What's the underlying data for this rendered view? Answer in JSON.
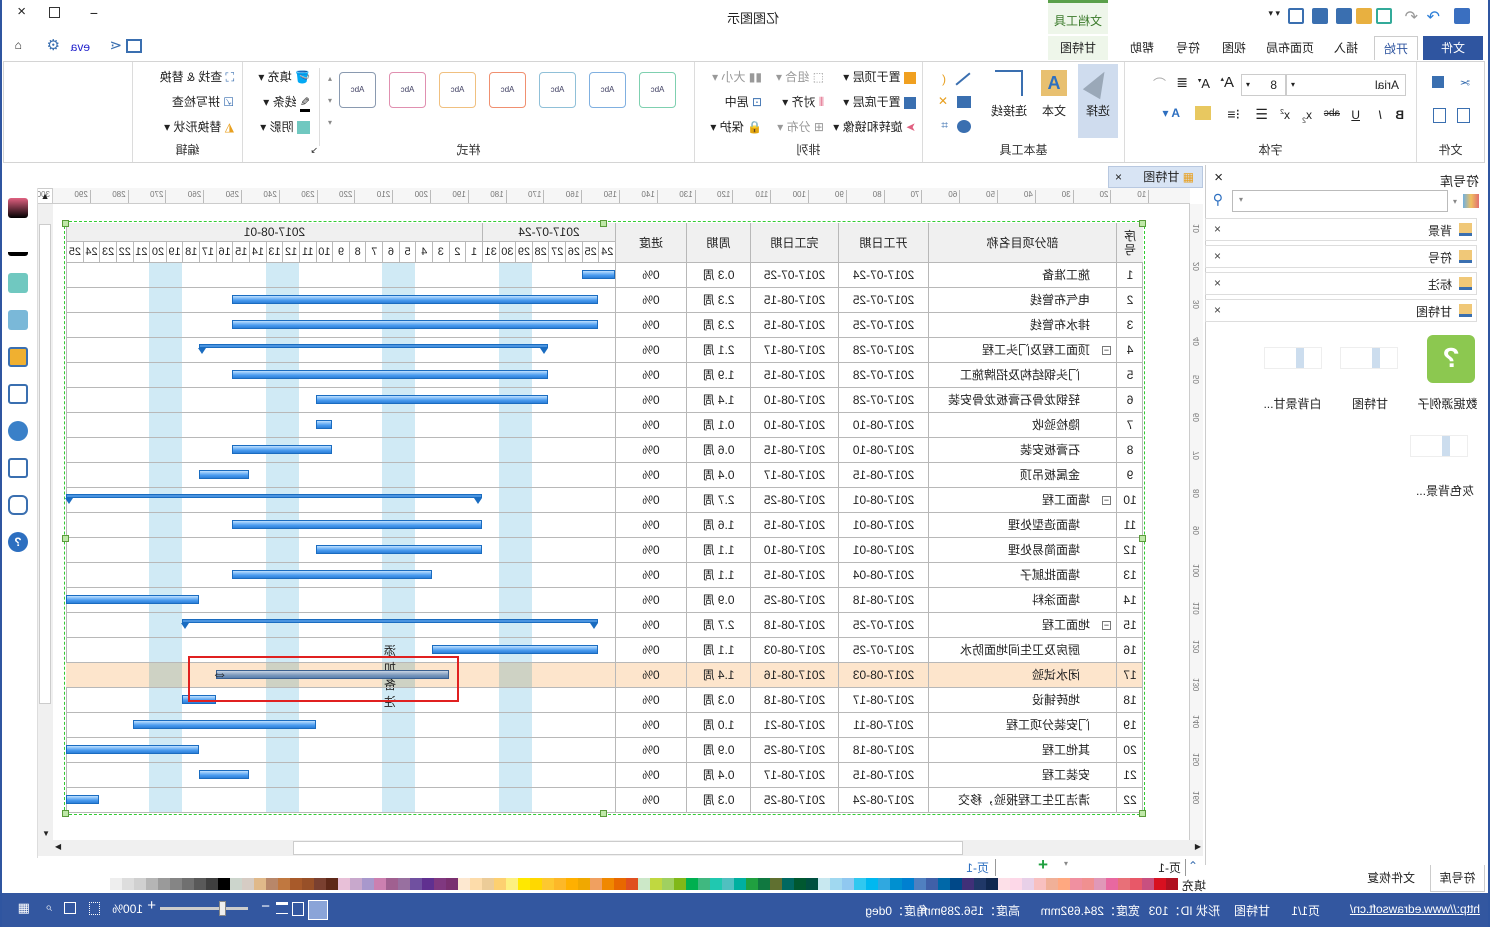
{
  "app": {
    "title": "亿图图示",
    "context_tab": "文档工具"
  },
  "quick_access": {
    "user": "eva"
  },
  "tabs": [
    "文件",
    "开始",
    "插入",
    "页面布局",
    "视图",
    "符号",
    "帮助",
    "甘特图"
  ],
  "active_tab": "开始",
  "ribbon": {
    "file_group": "文件",
    "font_group": {
      "label": "字体",
      "font_name": "Arial",
      "font_size": "8"
    },
    "tools_group": {
      "label": "基本工具",
      "select": "选择",
      "text": "文本",
      "connector": "连接线"
    },
    "arrange_group": {
      "label": "排列",
      "bring_front": "置于顶层",
      "send_back": "置于底层",
      "rotate": "旋转和镜像",
      "align": "对齐",
      "group": "组合",
      "distribute": "分布",
      "size": "大小",
      "center": "居中",
      "protect": "保护"
    },
    "style_group": {
      "label": "样式",
      "sample": "Abc",
      "fill": "填充",
      "line": "线条",
      "shadow": "阴影",
      "swatch_colors": [
        "#7fd0b0",
        "#80b0e0",
        "#90c0d8",
        "#f09070",
        "#f0c080",
        "#e090b0",
        "#8a9ab0"
      ]
    },
    "edit_group": {
      "label": "编辑",
      "find": "查找 & 替换",
      "spell": "拼写检查",
      "replace_shape": "替换形状"
    }
  },
  "library": {
    "title": "符号库",
    "categories": [
      "背景",
      "符号",
      "标注",
      "甘特图"
    ],
    "items": [
      {
        "label": "数据源例子",
        "icon": "help-bubble-icon"
      },
      {
        "label": "甘特图",
        "icon": "gantt-thumbnail"
      },
      {
        "label": "白背景甘...",
        "icon": "gantt-thumbnail"
      },
      {
        "label": "灰色背景...",
        "icon": "gantt-thumbnail"
      }
    ],
    "bottom_tabs": [
      "符号库",
      "文件恢复"
    ]
  },
  "document_tab": "甘特图",
  "ruler": {
    "h_labels": [
      10,
      20,
      30,
      40,
      50,
      60,
      70,
      80,
      90,
      100,
      110,
      120,
      130,
      140,
      150,
      160,
      170,
      180,
      190,
      200,
      210,
      220,
      230,
      240,
      250,
      260,
      270,
      280,
      290,
      300
    ],
    "v_labels": [
      10,
      20,
      30,
      40,
      50,
      60,
      70,
      80,
      90,
      100,
      110,
      120,
      130,
      140,
      150,
      160
    ]
  },
  "gantt": {
    "headers": {
      "id": "序号",
      "name": "部分项目名称",
      "start": "开工日期",
      "end": "完工日期",
      "duration": "周期",
      "progress": "进度"
    },
    "timeline_start": "2017-07-24",
    "timeline_end": "2017-08-25",
    "week_labels": [
      "2017-07-24",
      "2017-08-01"
    ],
    "day_labels": [
      "24",
      "25",
      "26",
      "27",
      "28",
      "29",
      "30",
      "31",
      "1",
      "2",
      "3",
      "4",
      "5",
      "6",
      "7",
      "8",
      "9",
      "10",
      "11",
      "12",
      "13",
      "14",
      "15",
      "16",
      "17",
      "18",
      "19",
      "20",
      "21",
      "22",
      "23",
      "24",
      "25"
    ],
    "selected_row": 17,
    "annotation": "添加备注",
    "rows": [
      {
        "id": "1",
        "name": "施工准备",
        "start": "2017-07-24",
        "end": "2017-07-25",
        "duration": "0.3 周",
        "progress": "0%",
        "level": 0
      },
      {
        "id": "2",
        "name": "电气布管线",
        "start": "2017-07-25",
        "end": "2017-08-15",
        "duration": "2.3 周",
        "progress": "0%",
        "level": 0
      },
      {
        "id": "3",
        "name": "排水布管线",
        "start": "2017-07-25",
        "end": "2017-08-15",
        "duration": "2.3 周",
        "progress": "0%",
        "level": 0
      },
      {
        "id": "4",
        "name": "顶面工程及门头工程",
        "start": "2017-07-28",
        "end": "2017-08-17",
        "duration": "2.1 周",
        "progress": "0%",
        "level": 0,
        "summary": true
      },
      {
        "id": "5",
        "name": "门头钢结构及招牌施工",
        "start": "2017-07-28",
        "end": "2017-08-15",
        "duration": "1.9 周",
        "progress": "0%",
        "level": 1
      },
      {
        "id": "6",
        "name": "轻钢龙骨石膏板龙骨安装",
        "start": "2017-07-28",
        "end": "2017-08-10",
        "duration": "1.4 周",
        "progress": "0%",
        "level": 1
      },
      {
        "id": "7",
        "name": "隐检验收",
        "start": "2017-08-10",
        "end": "2017-08-10",
        "duration": "0.1 周",
        "progress": "0%",
        "level": 1
      },
      {
        "id": "8",
        "name": "石膏板安装",
        "start": "2017-08-10",
        "end": "2017-08-15",
        "duration": "0.6 周",
        "progress": "0%",
        "level": 1
      },
      {
        "id": "9",
        "name": "金属板吊顶",
        "start": "2017-08-15",
        "end": "2017-08-17",
        "duration": "0.4 周",
        "progress": "0%",
        "level": 1
      },
      {
        "id": "10",
        "name": "墙面工程",
        "start": "2017-08-01",
        "end": "2017-08-25",
        "duration": "2.7 周",
        "progress": "0%",
        "level": 0,
        "summary": true
      },
      {
        "id": "11",
        "name": "墙面造型处理",
        "start": "2017-08-01",
        "end": "2017-08-15",
        "duration": "1.6 周",
        "progress": "0%",
        "level": 1
      },
      {
        "id": "12",
        "name": "墙面简易处理",
        "start": "2017-08-01",
        "end": "2017-08-10",
        "duration": "1.1 周",
        "progress": "0%",
        "level": 1
      },
      {
        "id": "13",
        "name": "墙面批腻子",
        "start": "2017-08-04",
        "end": "2017-08-15",
        "duration": "1.1 周",
        "progress": "0%",
        "level": 1
      },
      {
        "id": "14",
        "name": "墙面涂料",
        "start": "2017-08-18",
        "end": "2017-08-25",
        "duration": "0.9 周",
        "progress": "0%",
        "level": 1
      },
      {
        "id": "15",
        "name": "地面工程",
        "start": "2017-07-25",
        "end": "2017-08-18",
        "duration": "2.7 周",
        "progress": "0%",
        "level": 0,
        "summary": true
      },
      {
        "id": "16",
        "name": "厨房及卫生间地面防水",
        "start": "2017-07-25",
        "end": "2017-08-03",
        "duration": "1.1 周",
        "progress": "0%",
        "level": 1
      },
      {
        "id": "17",
        "name": "闭水试验",
        "start": "2017-08-03",
        "end": "2017-08-16",
        "duration": "1.4 周",
        "progress": "0%",
        "level": 1
      },
      {
        "id": "18",
        "name": "地砖铺设",
        "start": "2017-08-17",
        "end": "2017-08-18",
        "duration": "0.3 周",
        "progress": "0%",
        "level": 1
      },
      {
        "id": "19",
        "name": "门安装分项工程",
        "start": "2017-08-11",
        "end": "2017-08-21",
        "duration": "1.0 周",
        "progress": "0%",
        "level": 0
      },
      {
        "id": "20",
        "name": "其他工程",
        "start": "2017-08-18",
        "end": "2017-08-25",
        "duration": "0.9 周",
        "progress": "0%",
        "level": 0
      },
      {
        "id": "21",
        "name": "安装工程",
        "start": "2017-08-15",
        "end": "2017-08-17",
        "duration": "0.4 周",
        "progress": "0%",
        "level": 0
      },
      {
        "id": "22",
        "name": "清洁卫生工程报验，移交",
        "start": "2017-08-24",
        "end": "2017-08-25",
        "duration": "0.3 周",
        "progress": "0%",
        "level": 0
      }
    ]
  },
  "pages": {
    "current": "页-1",
    "tab": "页-1"
  },
  "palette": {
    "label": "填充",
    "colors": [
      "#eeeeee",
      "#dddddd",
      "#d0d0d0",
      "#b5b5b5",
      "#9a9a9a",
      "#858585",
      "#707070",
      "#595959",
      "#3f3f3f",
      "#000000",
      "#ccd5cc",
      "#d6ccc4",
      "#e0b98a",
      "#b8876a",
      "#c07840",
      "#a85a2a",
      "#985028",
      "#7a4030",
      "#5e2818",
      "#e8c0d8",
      "#c8a8cc",
      "#a898cc",
      "#cc80b0",
      "#a06090",
      "#9870a0",
      "#7050a0",
      "#603090",
      "#803880",
      "#7a3070",
      "#fde8d0",
      "#fddcaa",
      "#eccc98",
      "#fdd070",
      "#fdf080",
      "#ffe800",
      "#ffd800",
      "#fdc830",
      "#fdb828",
      "#ffb000",
      "#f0a800",
      "#f0a060",
      "#f08800",
      "#e86800",
      "#e05020",
      "#cce8c8",
      "#c0d840",
      "#a0d060",
      "#80b818",
      "#00b050",
      "#40b880",
      "#20c8b0",
      "#50c0c0",
      "#00b0a0",
      "#20a040",
      "#107840",
      "#607030",
      "#006860",
      "#005830",
      "#005040",
      "#c8e8f0",
      "#a0d8f0",
      "#90c8f0",
      "#30c8f0",
      "#00b8f0",
      "#30a8e0",
      "#0090d0",
      "#0080d0",
      "#5080c0",
      "#4060a8",
      "#0068a8",
      "#004888",
      "#403078",
      "#203868",
      "#102850",
      "#fde0e8",
      "#fdd8e8",
      "#e8d0e8",
      "#f8c0c0",
      "#f0b098",
      "#ffa880",
      "#f090a0",
      "#f09090",
      "#e098b8",
      "#e868a0",
      "#e87078",
      "#e85868",
      "#c85080",
      "#d81020",
      "#b01020"
    ]
  },
  "status": {
    "url": "http://www.edrawsoft.cn/",
    "page": "页1/1",
    "shape_name": "甘特图",
    "shape_id": "形状 ID：103",
    "width": "宽度：284.692mm",
    "height": "高度：156.289mm",
    "angle": "角度：0deg",
    "zoom": "100%",
    "zoom_fraction": 0.7
  },
  "colors": {
    "accent": "#2f55a0",
    "selection": "#fde5cc",
    "bar": "#2d7fd8",
    "weekend": "#d0eaf5"
  }
}
